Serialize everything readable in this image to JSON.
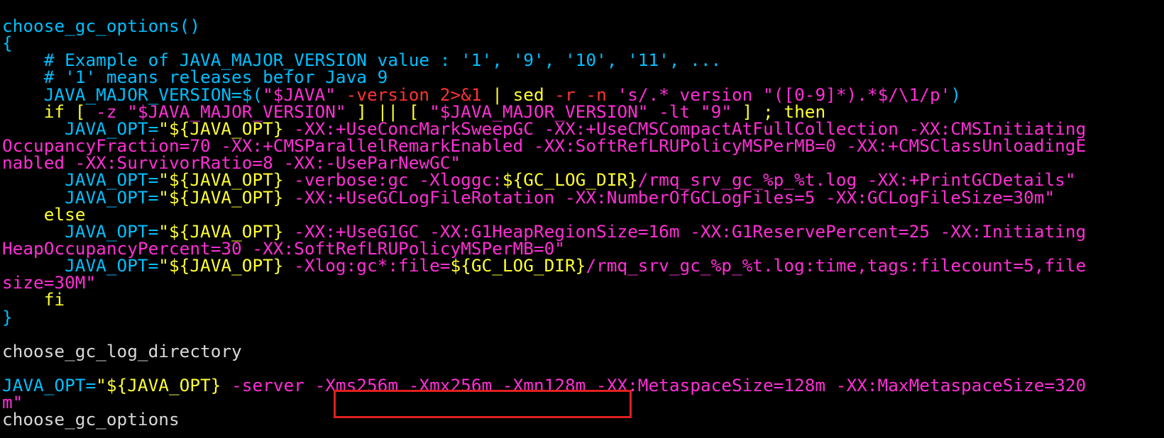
{
  "colors": {
    "background": "#000000",
    "cyan": "#00bfff",
    "magenta": "#ff2fd6",
    "yellow": "#ffff33",
    "white": "#d8d8d8",
    "red": "#ff3333",
    "highlight_border": "#e02020"
  },
  "lines": [
    {
      "spans": [
        {
          "text": "choose_gc_options()",
          "color": "cyan"
        }
      ]
    },
    {
      "spans": [
        {
          "text": "{",
          "color": "cyan"
        }
      ]
    },
    {
      "spans": [
        {
          "text": "    # Example of JAVA_MAJOR_VERSION value : '1', '9', '10', '11', ...",
          "color": "cyan"
        }
      ]
    },
    {
      "spans": [
        {
          "text": "    # '1' means releases befor Java 9",
          "color": "cyan"
        }
      ]
    },
    {
      "spans": [
        {
          "text": "    JAVA_MAJOR_VERSION=$(",
          "color": "cyan"
        },
        {
          "text": "\"$JAVA\"",
          "color": "magenta"
        },
        {
          "text": " -version ",
          "color": "red"
        },
        {
          "text": "2>&1",
          "color": "red"
        },
        {
          "text": " | ",
          "color": "yellow"
        },
        {
          "text": "sed",
          "color": "yellow"
        },
        {
          "text": " -r -n ",
          "color": "red"
        },
        {
          "text": "'s/.* version \"([0-9]*).*$/\\1/p'",
          "color": "magenta"
        },
        {
          "text": ")",
          "color": "cyan"
        }
      ]
    },
    {
      "spans": [
        {
          "text": "    if [ ",
          "color": "yellow"
        },
        {
          "text": "-z ",
          "color": "magenta"
        },
        {
          "text": "\"$JAVA_MAJOR_VERSION\"",
          "color": "magenta"
        },
        {
          "text": " ] || [ ",
          "color": "yellow"
        },
        {
          "text": "\"$JAVA_MAJOR_VERSION\"",
          "color": "magenta"
        },
        {
          "text": " -lt ",
          "color": "magenta"
        },
        {
          "text": "\"9\"",
          "color": "magenta"
        },
        {
          "text": " ] ; then",
          "color": "yellow"
        }
      ]
    },
    {
      "spans": [
        {
          "text": "      JAVA_OPT=",
          "color": "cyan"
        },
        {
          "text": "\"${JAVA_OPT}",
          "color": "yellow"
        },
        {
          "text": " -XX:+UseConcMarkSweepGC -XX:+UseCMSCompactAtFullCollection -XX:CMSInitiating",
          "color": "magenta"
        }
      ]
    },
    {
      "spans": [
        {
          "text": "OccupancyFraction=70 -XX:+CMSParallelRemarkEnabled -XX:SoftRefLRUPolicyMSPerMB=0 -XX:+CMSClassUnloadingE",
          "color": "magenta"
        }
      ]
    },
    {
      "spans": [
        {
          "text": "nabled -XX:SurvivorRatio=8 -XX:-UseParNewGC\"",
          "color": "magenta"
        }
      ]
    },
    {
      "spans": [
        {
          "text": "      JAVA_OPT=",
          "color": "cyan"
        },
        {
          "text": "\"${JAVA_OPT}",
          "color": "yellow"
        },
        {
          "text": " -verbose:gc -Xloggc:",
          "color": "magenta"
        },
        {
          "text": "${GC_LOG_DIR}",
          "color": "yellow"
        },
        {
          "text": "/rmq_srv_gc_%p_%t.log -XX:+PrintGCDetails\"",
          "color": "magenta"
        }
      ]
    },
    {
      "spans": [
        {
          "text": "      JAVA_OPT=",
          "color": "cyan"
        },
        {
          "text": "\"${JAVA_OPT}",
          "color": "yellow"
        },
        {
          "text": " -XX:+UseGCLogFileRotation -XX:NumberOfGCLogFiles=5 -XX:GCLogFileSize=30m\"",
          "color": "magenta"
        }
      ]
    },
    {
      "spans": [
        {
          "text": "    else",
          "color": "yellow"
        }
      ]
    },
    {
      "spans": [
        {
          "text": "      JAVA_OPT=",
          "color": "cyan"
        },
        {
          "text": "\"${JAVA_OPT}",
          "color": "yellow"
        },
        {
          "text": " -XX:+UseG1GC -XX:G1HeapRegionSize=16m -XX:G1ReservePercent=25 -XX:Initiating",
          "color": "magenta"
        }
      ]
    },
    {
      "spans": [
        {
          "text": "HeapOccupancyPercent=30 -XX:SoftRefLRUPolicyMSPerMB=0\"",
          "color": "magenta"
        }
      ]
    },
    {
      "spans": [
        {
          "text": "      JAVA_OPT=",
          "color": "cyan"
        },
        {
          "text": "\"${JAVA_OPT}",
          "color": "yellow"
        },
        {
          "text": " -Xlog:gc*:file=",
          "color": "magenta"
        },
        {
          "text": "${GC_LOG_DIR}",
          "color": "yellow"
        },
        {
          "text": "/rmq_srv_gc_%p_%t.log:time,tags:filecount=5,file",
          "color": "magenta"
        }
      ]
    },
    {
      "spans": [
        {
          "text": "size=30M\"",
          "color": "magenta"
        }
      ]
    },
    {
      "spans": [
        {
          "text": "    fi",
          "color": "yellow"
        }
      ]
    },
    {
      "spans": [
        {
          "text": "}",
          "color": "cyan"
        }
      ]
    },
    {
      "spans": [
        {
          "text": "",
          "color": "white"
        }
      ]
    },
    {
      "spans": [
        {
          "text": "choose_gc_log_directory",
          "color": "white"
        }
      ]
    },
    {
      "spans": [
        {
          "text": "",
          "color": "white"
        }
      ]
    },
    {
      "spans": [
        {
          "text": "JAVA_OPT=",
          "color": "cyan"
        },
        {
          "text": "\"${JAVA_OPT}",
          "color": "yellow"
        },
        {
          "text": " -server ",
          "color": "magenta"
        },
        {
          "text": "-Xms256m -Xmx256m -Xmn128m",
          "color": "magenta"
        },
        {
          "text": " -XX:MetaspaceSize=128m -XX:MaxMetaspaceSize=320",
          "color": "magenta"
        }
      ]
    },
    {
      "spans": [
        {
          "text": "m\"",
          "color": "magenta"
        }
      ]
    },
    {
      "spans": [
        {
          "text": "choose_gc_options",
          "color": "white"
        }
      ]
    }
  ],
  "highlight": {
    "label": "Xms Xmx Xmn highlighted region"
  }
}
